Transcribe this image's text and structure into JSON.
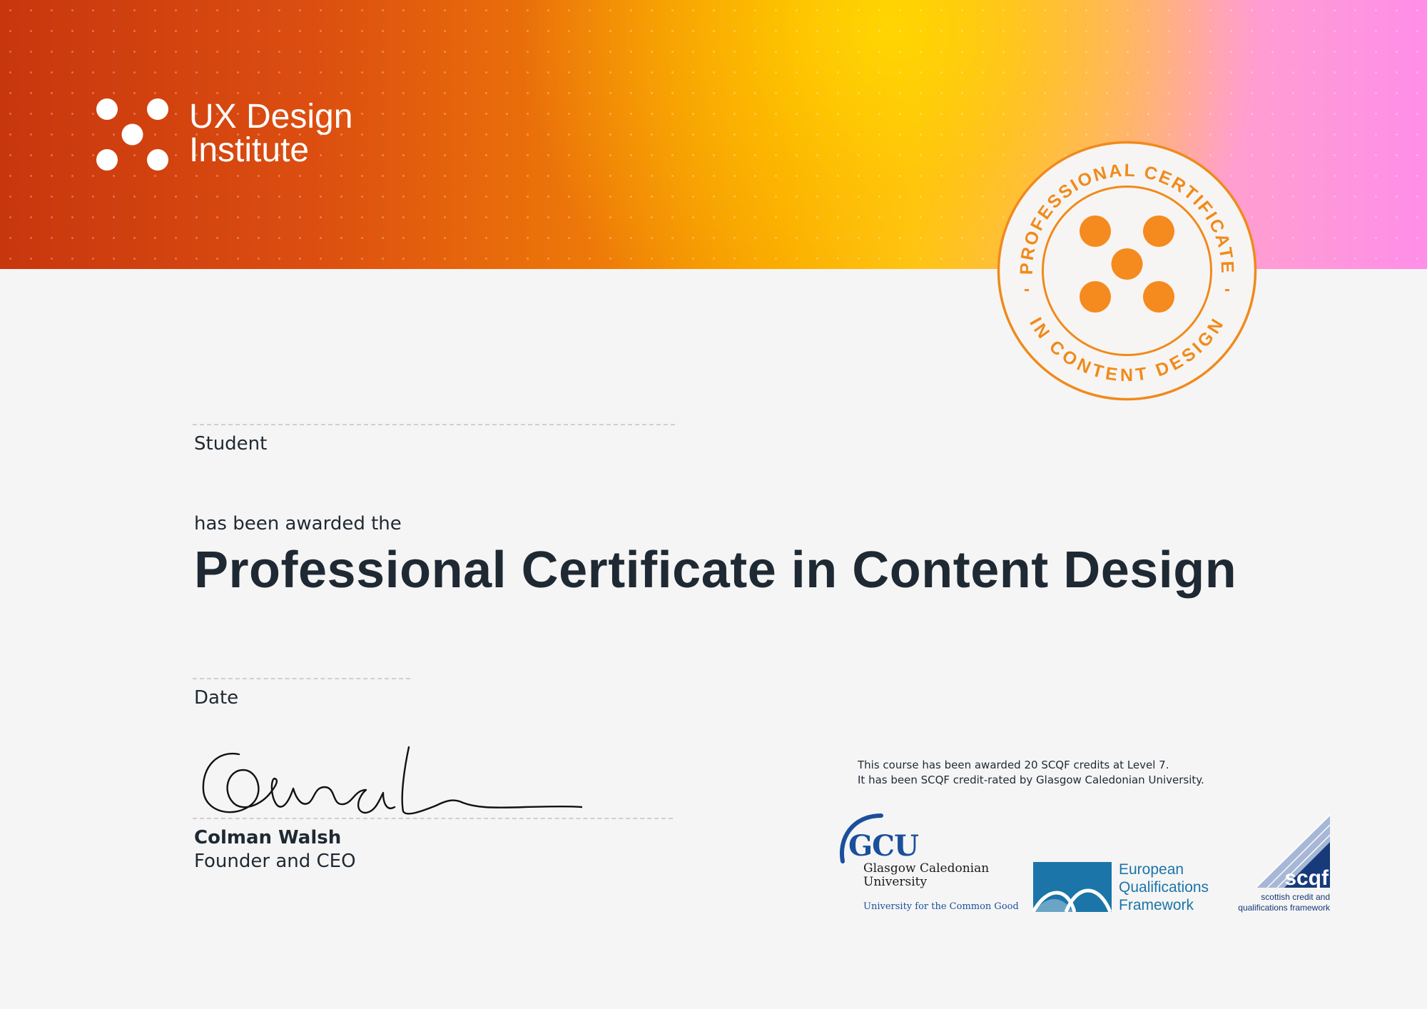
{
  "brand": {
    "name_line1": "UX Design",
    "name_line2": "Institute",
    "logo_icon": "five-dots-logo-icon"
  },
  "seal": {
    "arc_top": "PROFESSIONAL CERTIFICATE",
    "arc_bottom": "IN CONTENT DESIGN",
    "separator": "-",
    "icon": "five-dots-seal-icon",
    "color": "#f08a1c"
  },
  "certificate": {
    "student_label": "Student",
    "awarded_text": "has been awarded the",
    "title": "Professional Certificate in Content Design",
    "date_label": "Date"
  },
  "signatory": {
    "name": "Colman Walsh",
    "role": "Founder and CEO"
  },
  "accreditation": {
    "line1": "This course has been awarded 20 SCQF credits at Level 7.",
    "line2": "It has been SCQF credit-rated by Glasgow Caledonian University."
  },
  "logos": {
    "gcu": {
      "abbr": "GCU",
      "line1": "Glasgow Caledonian",
      "line2": "University",
      "tagline": "University for the Common Good"
    },
    "eqf": {
      "line1": "European",
      "line2": "Qualifications",
      "line3": "Framework"
    },
    "scqf": {
      "abbr": "scqf",
      "line1": "scottish credit and",
      "line2": "qualifications framework"
    }
  },
  "colors": {
    "text": "#1f2933",
    "seal_orange": "#f08a1c",
    "gcu_blue": "#1b4f9c",
    "eqf_blue": "#1b75a8",
    "scqf_blue": "#163a7a"
  }
}
